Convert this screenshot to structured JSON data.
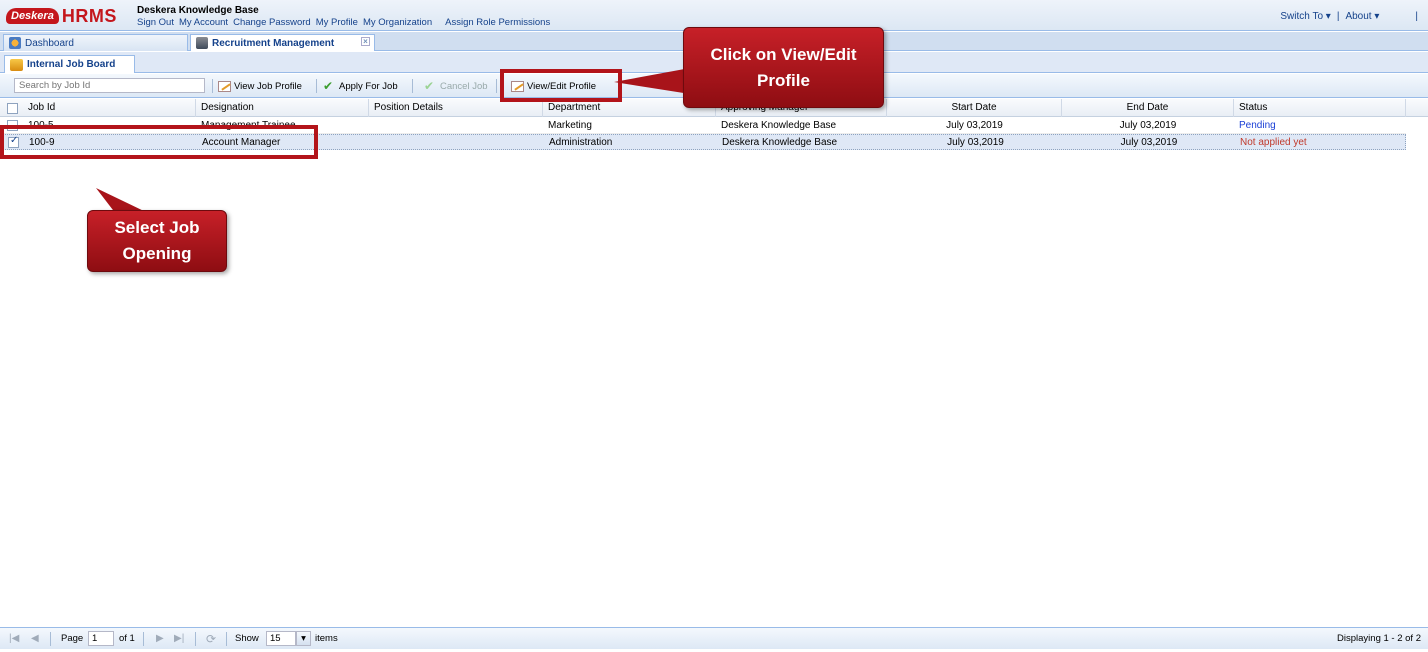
{
  "app": {
    "logo_badge": "Desk",
    "logo_suffix": "era",
    "logo_product": "HRMS",
    "org_name": "Deskera Knowledge Base",
    "top_links": [
      "Sign Out",
      "My Account",
      "Change Password",
      "My Profile",
      "My Organization",
      "Assign Role Permissions"
    ],
    "switch_to": "Switch To",
    "about": "About",
    "caret": "▾",
    "separator": "|"
  },
  "module_tabs": [
    {
      "label": "Dashboard",
      "icon": "dashboard-icon"
    },
    {
      "label": "Recruitment Management",
      "icon": "recruitment-icon",
      "close": "×"
    }
  ],
  "sub_tab": {
    "label": "Internal Job Board",
    "icon": "job-board-icon"
  },
  "toolbar": {
    "search_placeholder": "Search by Job Id",
    "view_job_profile": "View Job Profile",
    "apply_for_job": "Apply For Job",
    "cancel_job": "Cancel Job",
    "view_edit_profile": "View/Edit Profile"
  },
  "grid": {
    "columns": [
      "Job Id",
      "Designation",
      "Position Details",
      "Department",
      "Approving Manager",
      "Start Date",
      "End Date",
      "Status"
    ],
    "rows": [
      {
        "job_id": "100-5",
        "designation": "Management Trainee",
        "position_details": "",
        "department": "Marketing",
        "approving_manager": "Deskera Knowledge Base",
        "start_date": "July 03,2019",
        "end_date": "July 03,2019",
        "status": "Pending",
        "checked": false
      },
      {
        "job_id": "100-9",
        "designation": "Account Manager",
        "position_details": "",
        "department": "Administration",
        "approving_manager": "Deskera Knowledge Base",
        "start_date": "July 03,2019",
        "end_date": "July 03,2019",
        "status": "Not applied yet",
        "checked": true
      }
    ]
  },
  "callouts": {
    "view_edit": "Click on View/Edit Profile",
    "select_job": "Select Job Opening"
  },
  "footer": {
    "page_label": "Page",
    "page_value": "1",
    "of_label": "of 1",
    "show_label": "Show",
    "show_value": "15",
    "items_label": "items",
    "displaying": "Displaying 1 - 2 of 2",
    "first": "|◀",
    "prev": "◀",
    "next": "▶",
    "last": "▶|",
    "refresh": "⟳"
  },
  "colors": {
    "accent": "#c4161c",
    "link": "#15428b",
    "pending": "#1a3fd6",
    "not_applied": "#c0392b"
  }
}
